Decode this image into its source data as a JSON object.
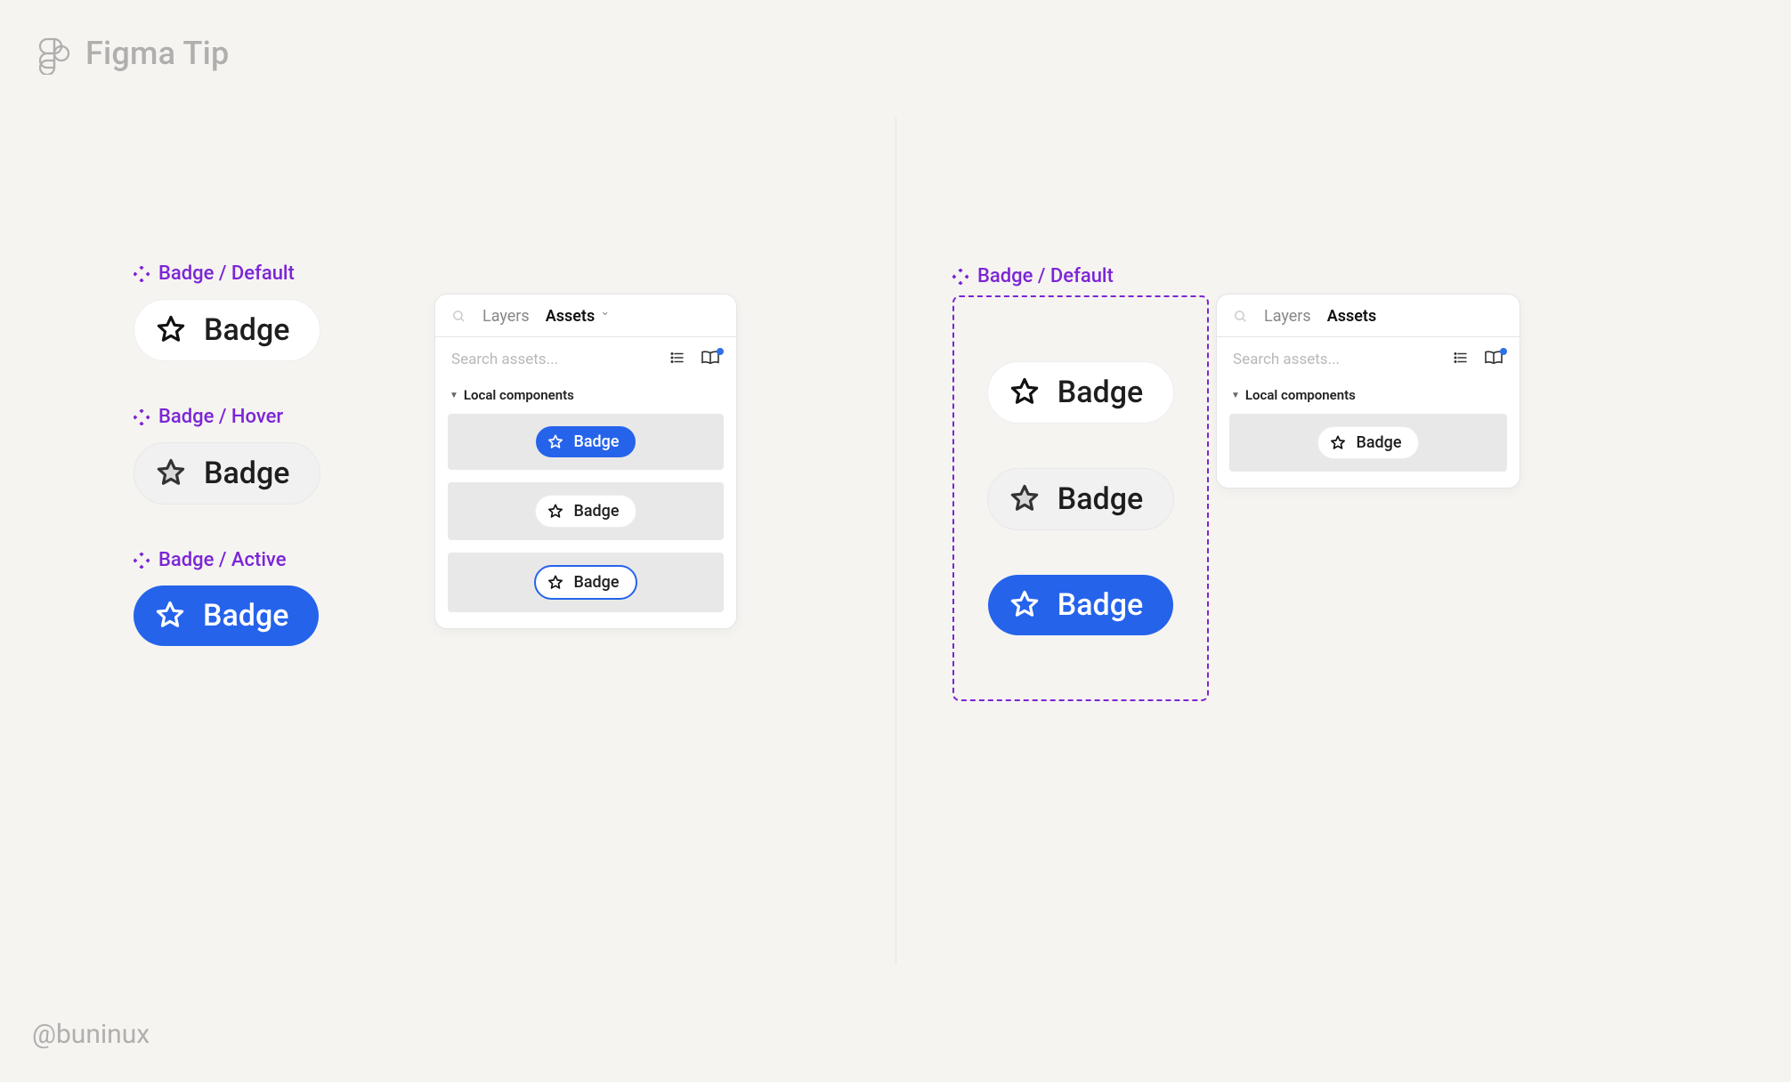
{
  "header": {
    "title": "Figma Tip"
  },
  "footer": {
    "handle": "@buninux"
  },
  "labels": {
    "badge_default": "Badge / Default",
    "badge_hover": "Badge / Hover",
    "badge_active": "Badge / Active"
  },
  "badge_text": "Badge",
  "panel": {
    "tab_layers": "Layers",
    "tab_assets": "Assets",
    "search_placeholder": "Search assets...",
    "section_title": "Local components"
  },
  "left_panel_rows": [
    "active",
    "default",
    "outlined"
  ],
  "right_panel_rows": [
    "default"
  ],
  "right_variants": [
    "default",
    "hover",
    "active"
  ]
}
